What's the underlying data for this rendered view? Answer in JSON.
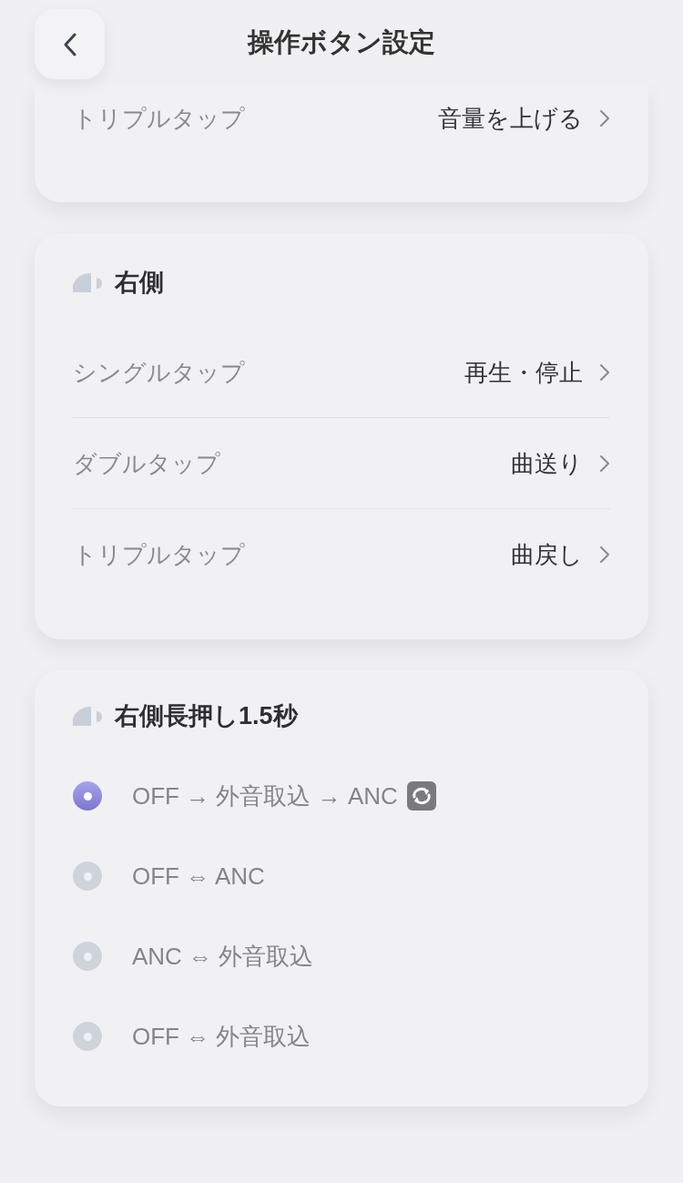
{
  "header": {
    "title": "操作ボタン設定"
  },
  "sections": [
    {
      "kind": "list",
      "rows": [
        {
          "label": "トリプルタップ",
          "value": "音量を上げる"
        }
      ]
    },
    {
      "kind": "list",
      "title": "右側",
      "rows": [
        {
          "label": "シングルタップ",
          "value": "再生・停止"
        },
        {
          "label": "ダブルタップ",
          "value": "曲送り"
        },
        {
          "label": "トリプルタップ",
          "value": "曲戻し"
        }
      ]
    },
    {
      "kind": "radio",
      "title": "右側長押し1.5秒",
      "options": [
        {
          "label": "OFF → 外音取込 → ANC",
          "selected": true,
          "cycle": true
        },
        {
          "label": "OFF ⇔ ANC",
          "selected": false,
          "cycle": false
        },
        {
          "label": "ANC ⇔ 外音取込",
          "selected": false,
          "cycle": false
        },
        {
          "label": "OFF ⇔ 外音取込",
          "selected": false,
          "cycle": false
        }
      ]
    }
  ]
}
